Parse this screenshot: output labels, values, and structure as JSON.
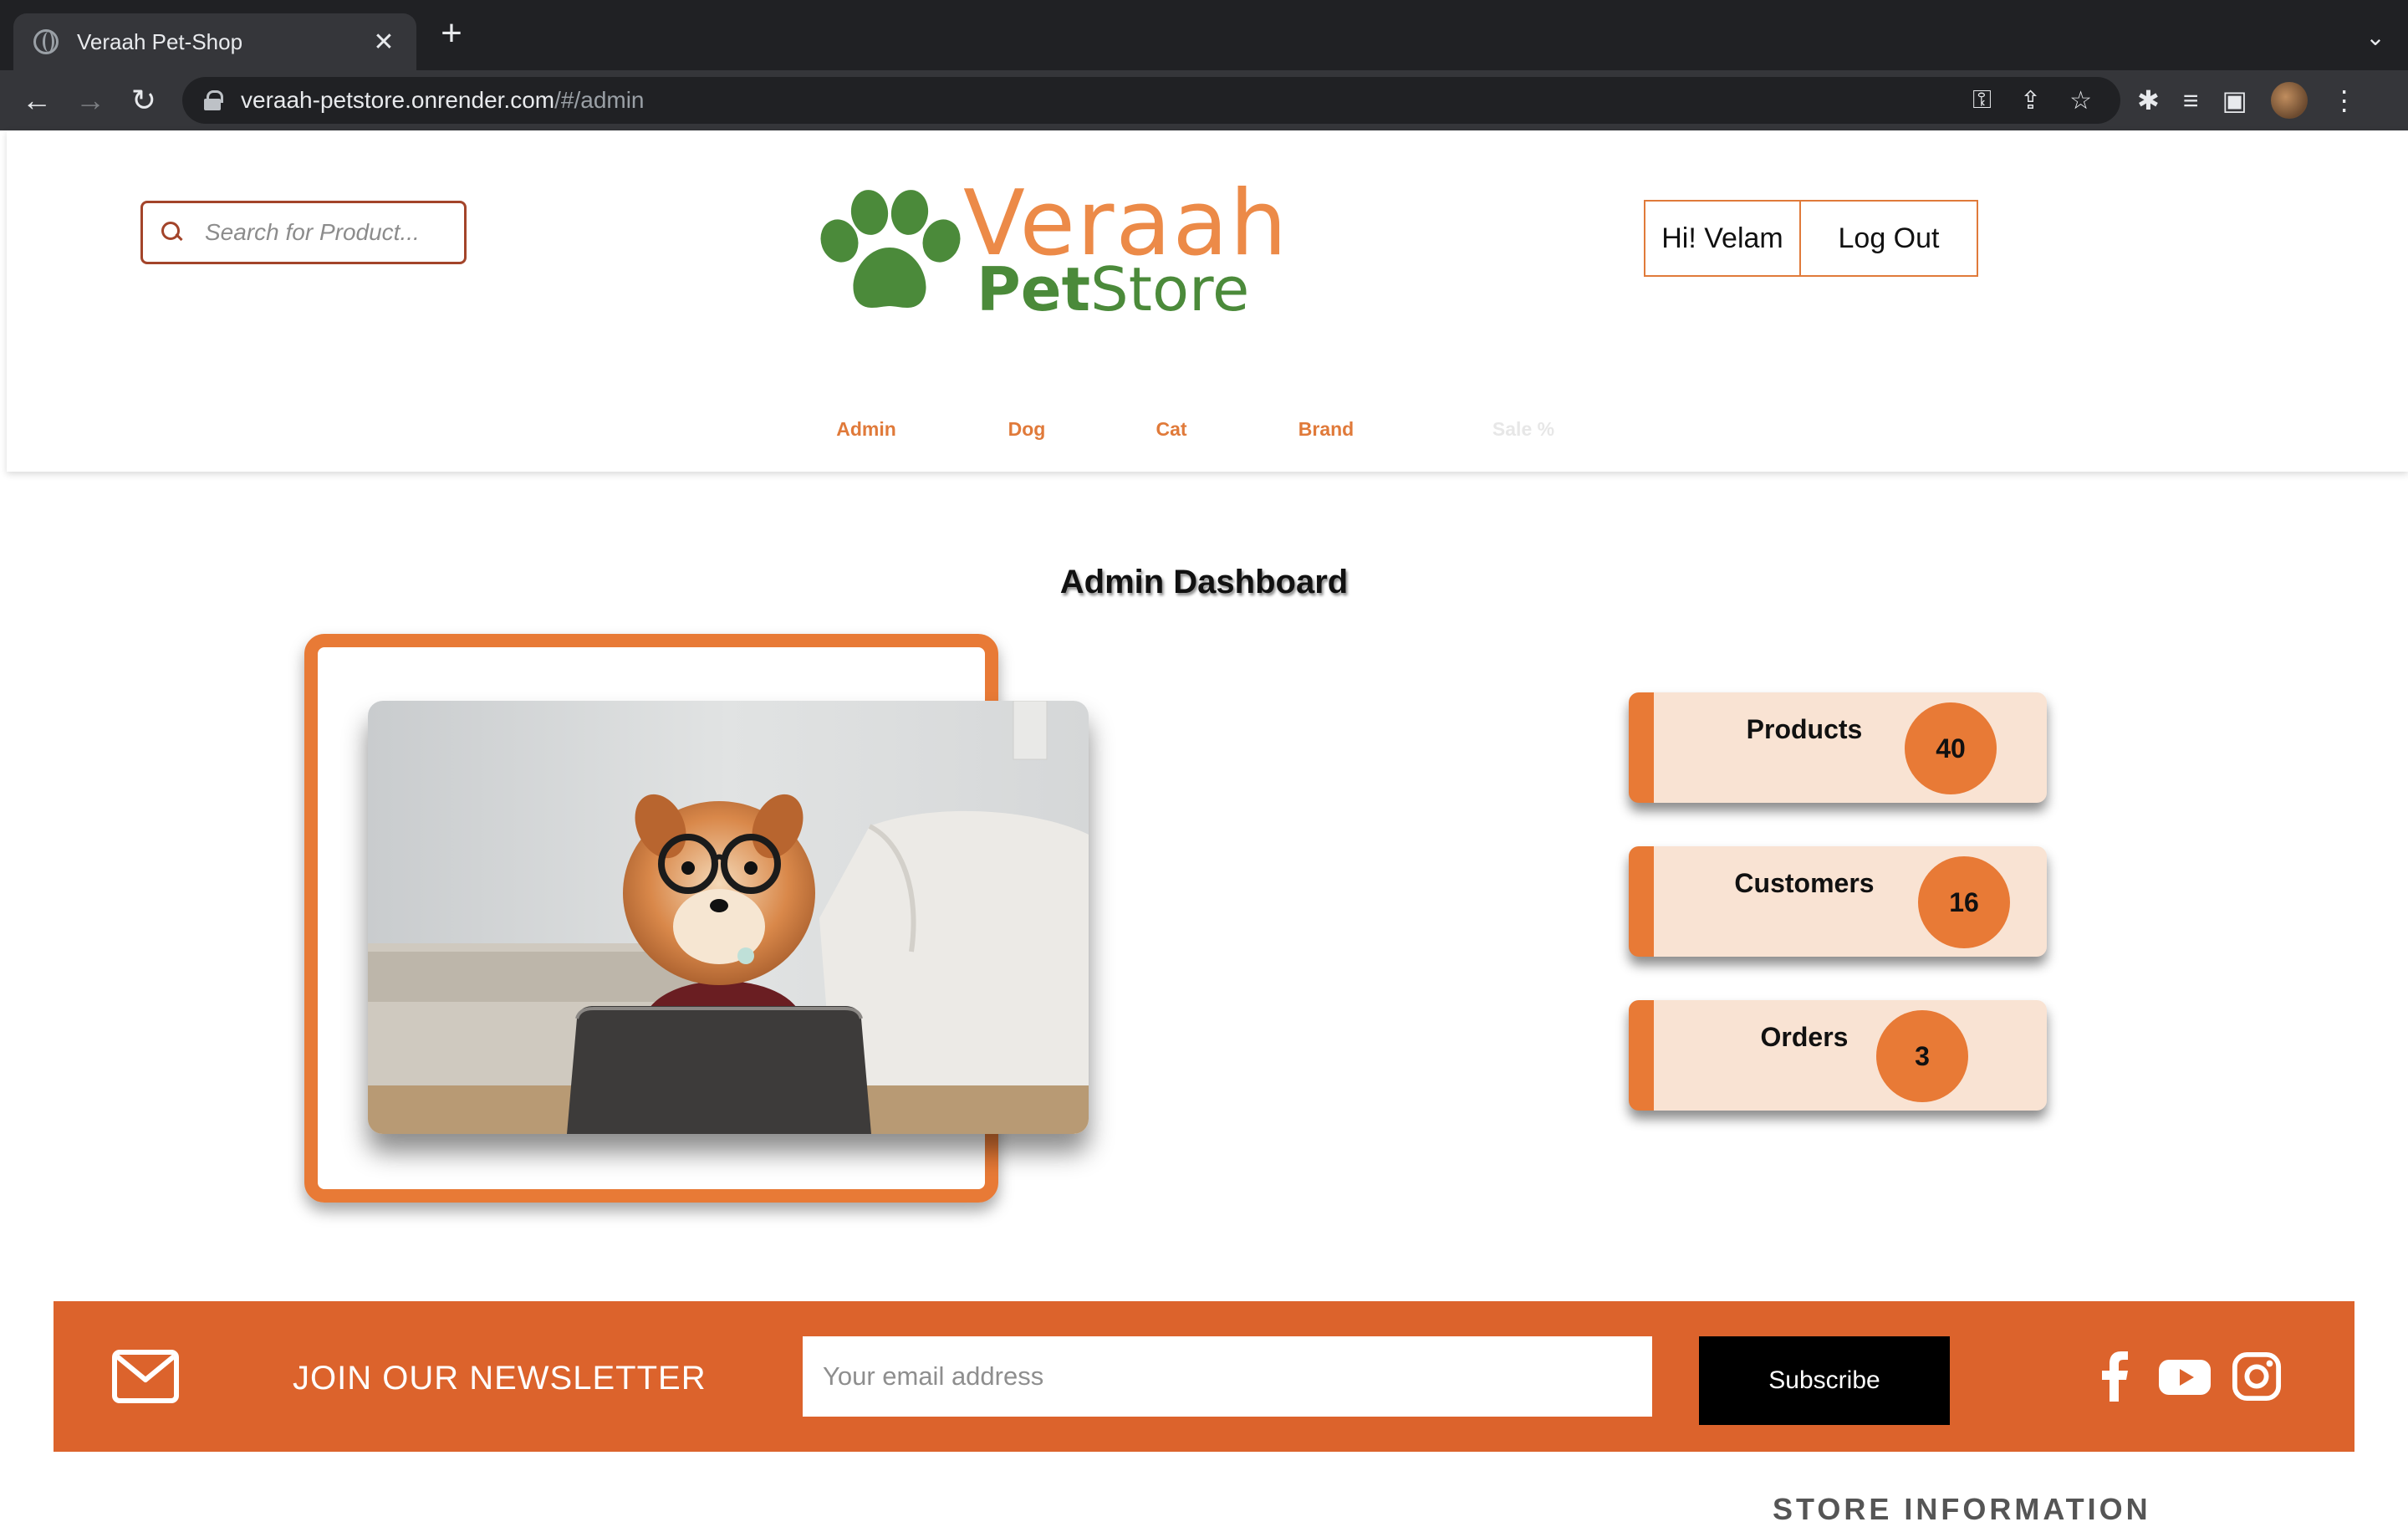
{
  "browser": {
    "tab_title": "Veraah Pet-Shop",
    "tab_close": "✕",
    "new_tab": "+",
    "url_host": "veraah-petstore.onrender.com",
    "url_path": "/#/admin",
    "icons": [
      "globe-icon",
      "close-icon",
      "plus-icon",
      "chevron-down-icon",
      "back-icon",
      "forward-icon",
      "reload-icon",
      "lock-icon",
      "key-icon",
      "share-icon",
      "star-icon",
      "puzzle-icon",
      "media-icon",
      "sidepanel-icon",
      "avatar",
      "menu-icon"
    ]
  },
  "header": {
    "search_placeholder": "Search for Product...",
    "logo_line1": "Veraah",
    "logo_line2_bold": "Pet",
    "logo_line2_rest": "Store",
    "greeting": "Hi! Velam",
    "logout_label": "Log Out"
  },
  "nav": {
    "items": [
      {
        "label": "Admin"
      },
      {
        "label": "Dog"
      },
      {
        "label": "Cat"
      },
      {
        "label": "Brand"
      },
      {
        "label": "Sale %"
      }
    ]
  },
  "dashboard": {
    "title": "Admin Dashboard",
    "stats": [
      {
        "label": "Products",
        "value": "40"
      },
      {
        "label": "Customers",
        "value": "16"
      },
      {
        "label": "Orders",
        "value": "3"
      }
    ]
  },
  "newsletter": {
    "heading": "JOIN OUR NEWSLETTER",
    "email_placeholder": "Your email address",
    "subscribe_label": "Subscribe"
  },
  "footer": {
    "peek_text": "STORE INFORMATION"
  },
  "colors": {
    "accent": "#e87a36",
    "newsletter_bg": "#dc632c",
    "logo_orange": "#ec8a48",
    "logo_green": "#4b8a3a",
    "card_bg": "#f9e3d3"
  }
}
